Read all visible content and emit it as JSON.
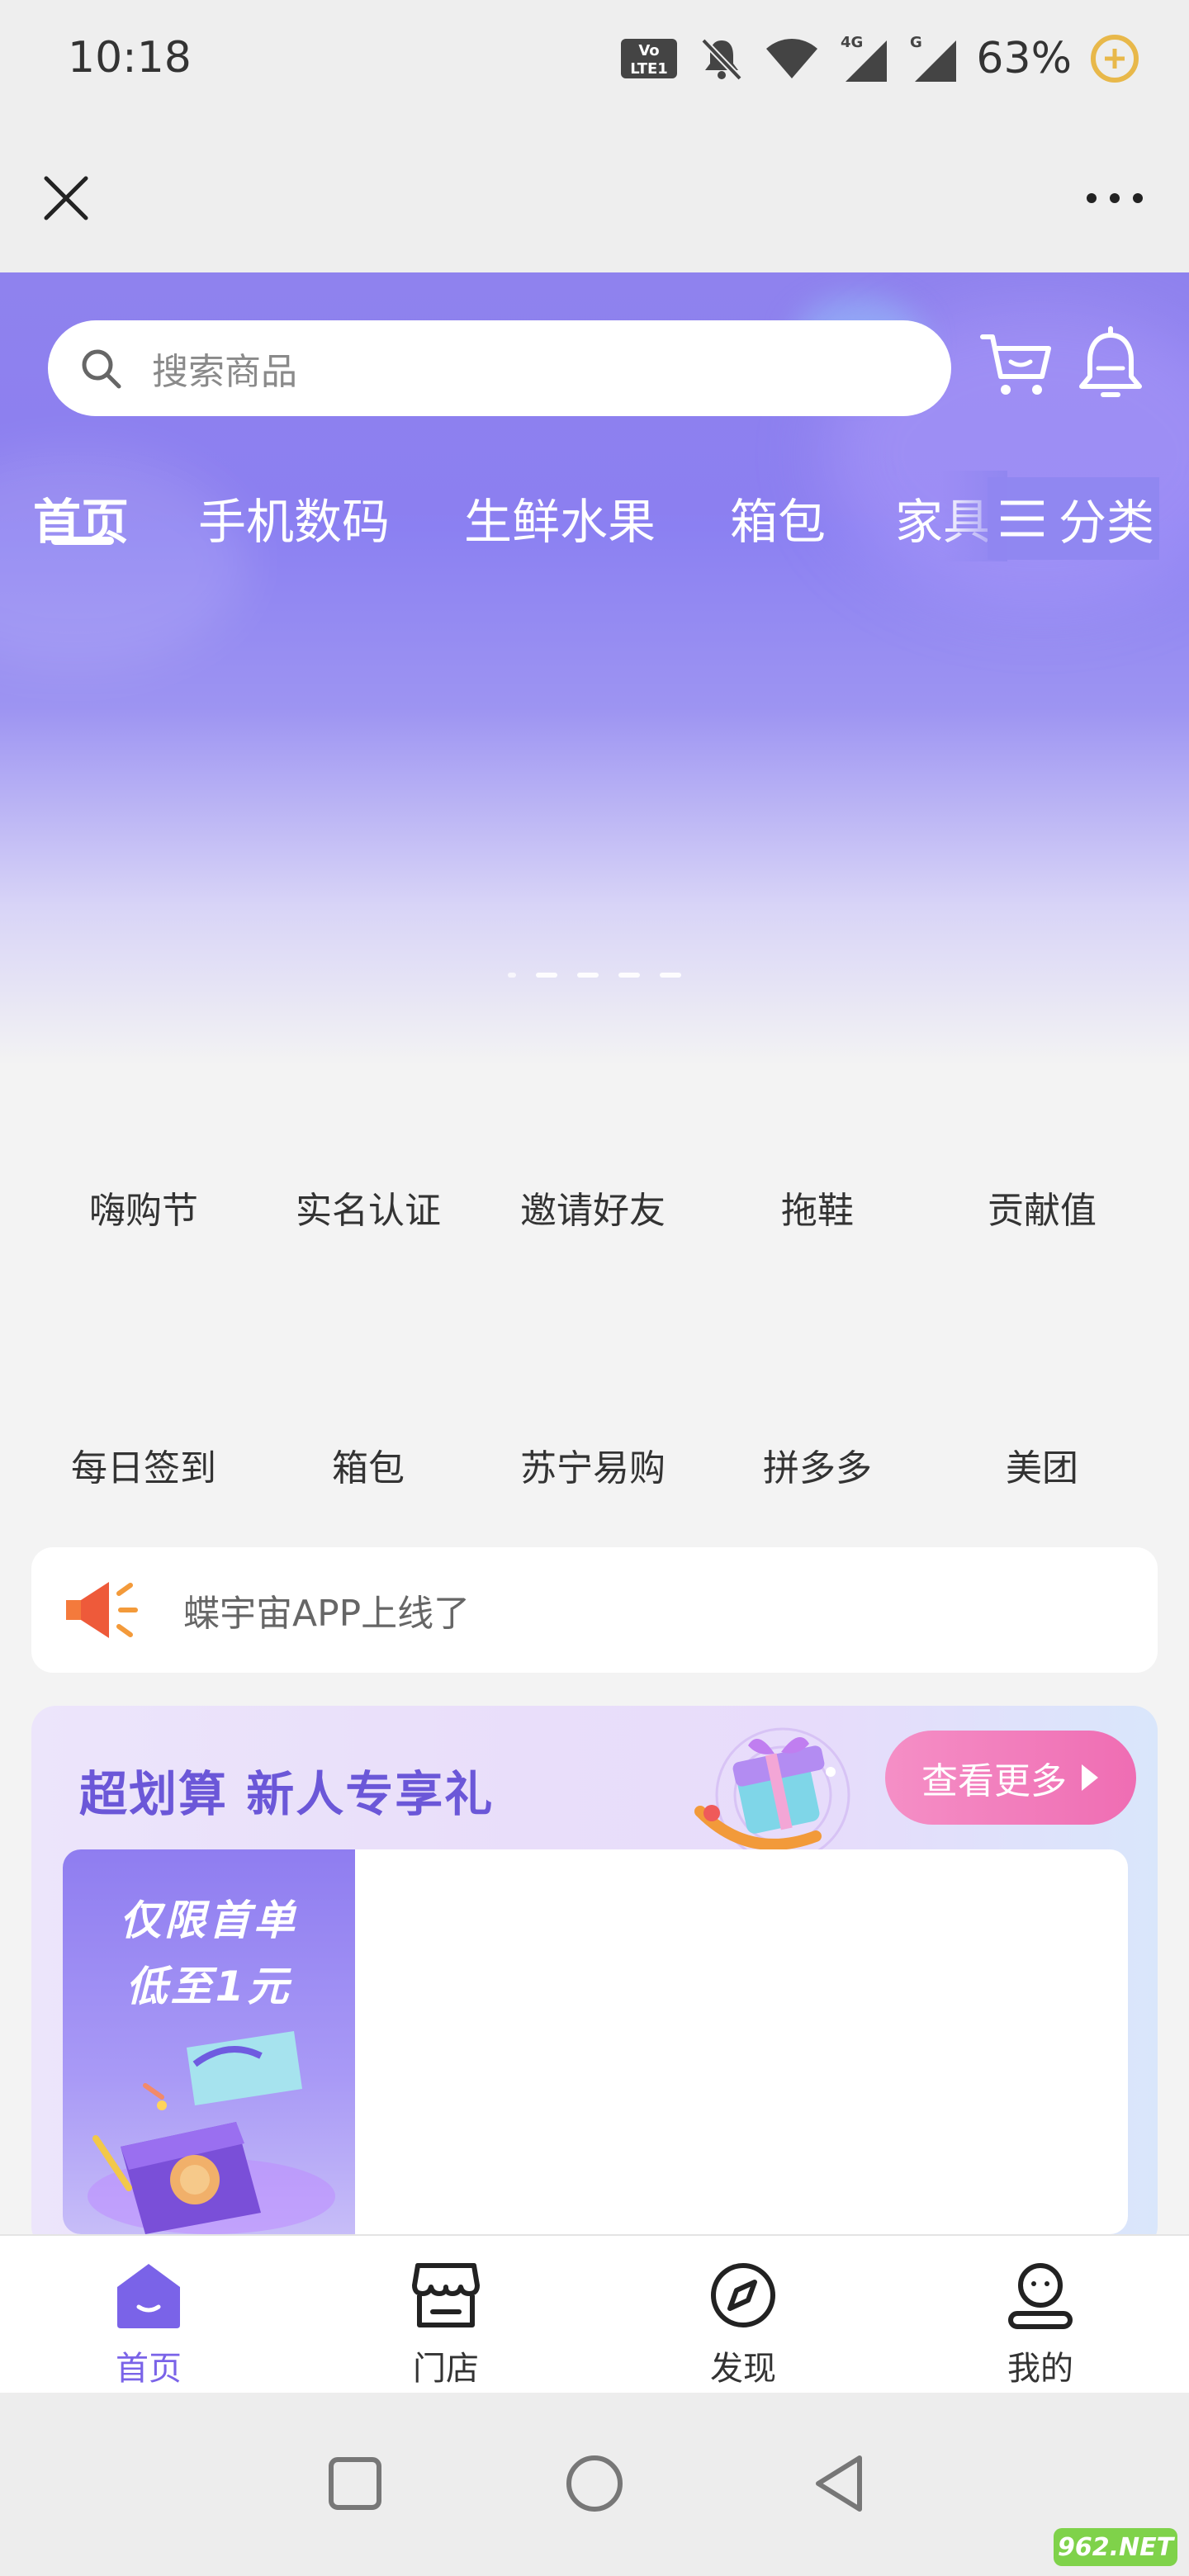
{
  "status_bar": {
    "time": "10:18",
    "battery_percent": "63%",
    "network_badges": [
      "Vo LTE 1",
      "4G",
      "G"
    ]
  },
  "top_bar": {
    "close_icon": "close-icon",
    "more_icon": "more-horizontal-icon"
  },
  "hero": {
    "search_placeholder": "搜索商品",
    "tabs": [
      "首页",
      "手机数码",
      "生鲜水果",
      "箱包",
      "家具"
    ],
    "active_tab": 0,
    "category_label": "分类",
    "carousel_pages": 4,
    "carousel_active": 0
  },
  "grid": {
    "row1": [
      "嗨购节",
      "实名认证",
      "邀请好友",
      "拖鞋",
      "贡献值"
    ],
    "row2": [
      "每日签到",
      "箱包",
      "苏宁易购",
      "拼多多",
      "美团"
    ]
  },
  "notice": {
    "text": "蝶宇宙APP上线了"
  },
  "promo": {
    "title": "超划算 新人专享礼",
    "more_label": "查看更多",
    "side_line1": "仅限首单",
    "side_line2": "低至1元"
  },
  "bottom_nav": {
    "items": [
      "首页",
      "门店",
      "发现",
      "我的"
    ],
    "active": 0
  },
  "watermark": {
    "text": "962.NET"
  },
  "colors": {
    "accent": "#7a63e8",
    "hero": "#8c7ff0",
    "promo_button": "#ef6db3"
  }
}
